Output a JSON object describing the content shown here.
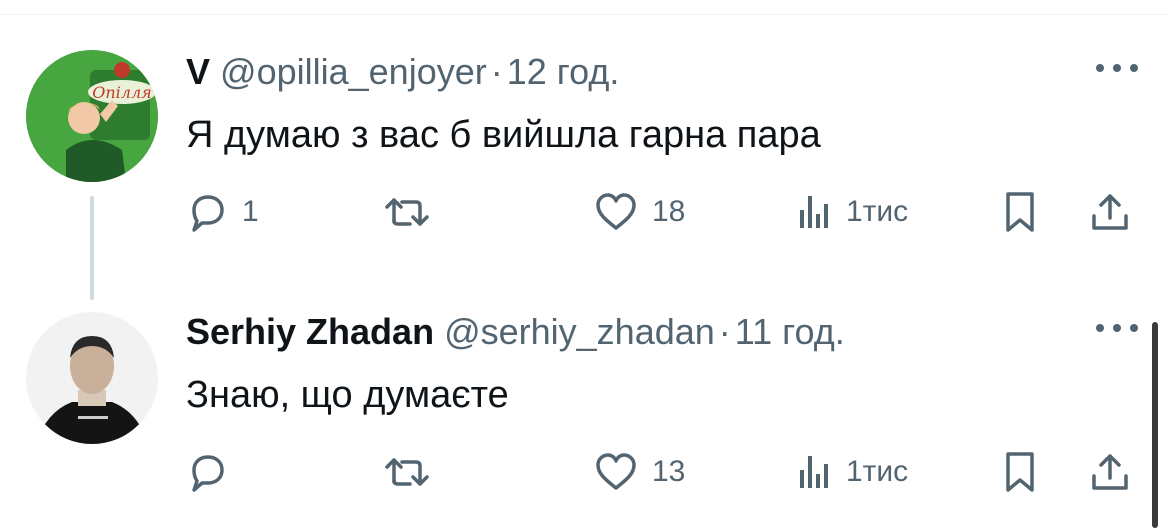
{
  "tweets": [
    {
      "name": "V",
      "handle": "@opillia_enjoyer",
      "separator": "·",
      "time": "12 год.",
      "text": "Я думаю з вас б вийшла гарна пара",
      "avatar_icon": "avatar-opillia-ad",
      "stats": {
        "replies": "1",
        "retweets": "",
        "likes": "18",
        "views": "1тис"
      }
    },
    {
      "name": "Serhiy Zhadan",
      "handle": "@serhiy_zhadan",
      "separator": "·",
      "time": "11 год.",
      "text": "Знаю, що думаєте",
      "avatar_icon": "avatar-person-photo",
      "stats": {
        "replies": "",
        "retweets": "",
        "likes": "13",
        "views": "1тис"
      }
    }
  ],
  "avatar_badge_text": "Опілля",
  "colors": {
    "text": "#0f1419",
    "secondary": "#536471",
    "thread_line": "#cfd9de",
    "divider": "#eff3f4"
  }
}
